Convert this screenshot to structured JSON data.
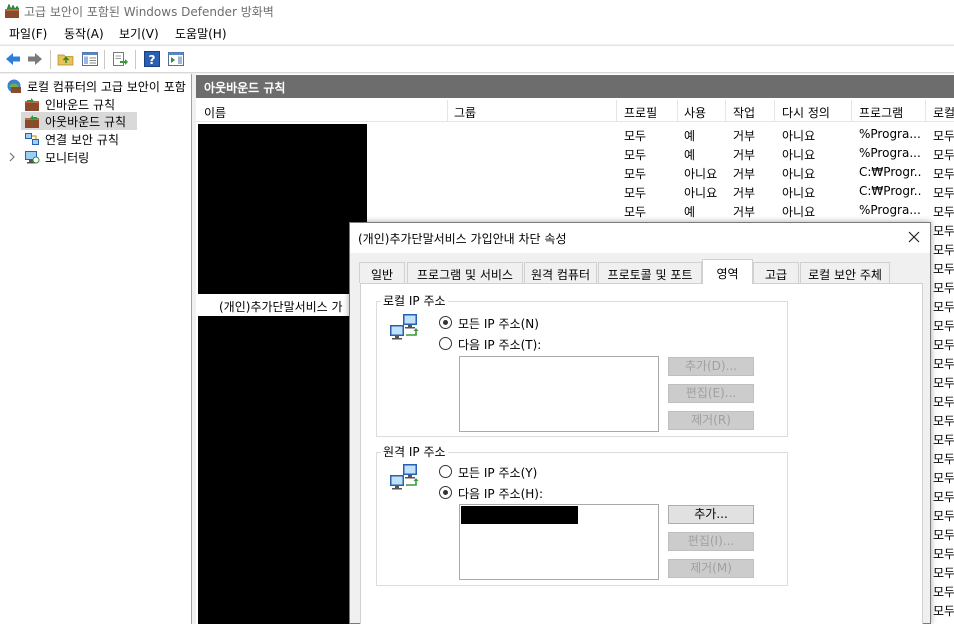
{
  "window": {
    "title": "고급 보안이 포함된 Windows Defender 방화벽"
  },
  "menu": [
    {
      "label": "파일(F)"
    },
    {
      "label": "동작(A)"
    },
    {
      "label": "보기(V)"
    },
    {
      "label": "도움말(H)"
    }
  ],
  "toolbar": {
    "icons": [
      "back-arrow-icon",
      "forward-arrow-icon",
      "folder-up-icon",
      "show-hide-console-tree-icon",
      "export-list-icon",
      "help-icon",
      "action-pane-icon"
    ]
  },
  "tree": {
    "root": "로컬 컴퓨터의 고급 보안이 포함",
    "items": [
      {
        "label": "인바운드 규칙"
      },
      {
        "label": "아웃바운드 규칙"
      },
      {
        "label": "연결 보안 규칙"
      },
      {
        "label": "모니터링"
      }
    ]
  },
  "pane": {
    "header": "아웃바운드 규칙",
    "columns": [
      "이름",
      "그룹",
      "프로필",
      "사용",
      "작업",
      "다시 정의",
      "프로그램",
      "로컬"
    ],
    "rows": [
      {
        "profile": "모두",
        "enabled": "예",
        "action": "거부",
        "override": "아니요",
        "program": "%Progra...",
        "local": "모두"
      },
      {
        "profile": "모두",
        "enabled": "예",
        "action": "거부",
        "override": "아니요",
        "program": "%Progra...",
        "local": "모두"
      },
      {
        "profile": "모두",
        "enabled": "아니요",
        "action": "거부",
        "override": "아니요",
        "program": "C:₩Progr...",
        "local": "모두"
      },
      {
        "profile": "모두",
        "enabled": "아니요",
        "action": "거부",
        "override": "아니요",
        "program": "C:₩Progr...",
        "local": "모두"
      },
      {
        "profile": "모두",
        "enabled": "예",
        "action": "거부",
        "override": "아니요",
        "program": "%Progra...",
        "local": "모두"
      }
    ],
    "selected_row_name": "(개인)추가단말서비스 가",
    "local_column_fill": "모두"
  },
  "dialog": {
    "title": "(개인)추가단말서비스 가입안내 차단 속성",
    "tabs": [
      {
        "label": "일반"
      },
      {
        "label": "프로그램 및 서비스"
      },
      {
        "label": "원격 컴퓨터"
      },
      {
        "label": "프로토콜 및 포트"
      },
      {
        "label": "영역"
      },
      {
        "label": "고급"
      },
      {
        "label": "로컬 보안 주체"
      }
    ],
    "local_ip": {
      "label": "로컬 IP 주소",
      "any": "모든 IP 주소(N)",
      "these": "다음 IP 주소(T):",
      "add": "추가(D)...",
      "edit": "편집(E)...",
      "remove": "제거(R)"
    },
    "remote_ip": {
      "label": "원격 IP 주소",
      "any": "모든 IP 주소(Y)",
      "these": "다음 IP 주소(H):",
      "add": "추가...",
      "edit": "편집(I)...",
      "remove": "제거(M)"
    }
  }
}
